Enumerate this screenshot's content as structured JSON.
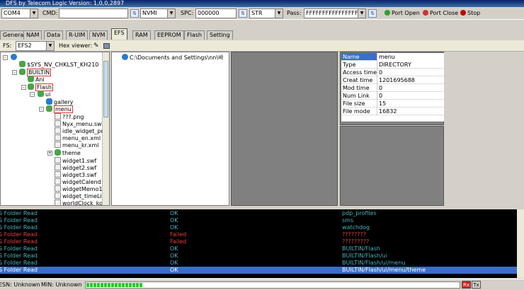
{
  "window": {
    "title": "DFS by Telecom Logic  Version: 1,0,0,2897"
  },
  "toolbar": {
    "port": "COM4",
    "cmd_label": "CMD:",
    "cmd_value": "",
    "nv_mode": "NVMI",
    "spc_label": "SPC:",
    "spc_value": "000000",
    "str_mode": "STR",
    "pass_label": "Pass:",
    "pass_value": "FFFFFFFFFFFFFFFF",
    "port_open": "Port Open",
    "port_close": "Port Close",
    "stop": "Stop"
  },
  "tabs": [
    "General",
    "NAM",
    "Data",
    "R-UIM",
    "NVM",
    "EFS",
    "RAM",
    "EEPROM",
    "Flash",
    "Setting"
  ],
  "active_tab": "EFS",
  "fsbar": {
    "fs_label": "FS:",
    "fs_value": "EFS2",
    "hex_label": "Hex viewer:"
  },
  "tree": {
    "root": "$SYS_NV_CHKLST_KH210",
    "builtin": "BUILTIN",
    "ani": "Ani",
    "flash": "Flash",
    "ui": "ui",
    "gallery": "gallery",
    "menu": "menu",
    "files": [
      "???.png",
      "Nyx_menu.sw",
      "idle_widget_pr",
      "menu_en.xml",
      "menu_kr.xml"
    ],
    "theme": "theme",
    "files2": [
      "widget1.swf",
      "widget2.swf",
      "widget3.swf",
      "widgetCalend",
      "widgetMemo1.",
      "widget_timeLis",
      "worldClock_ko"
    ]
  },
  "path": "C:\\Documents and Settings\\nn\\바",
  "info": [
    {
      "k": "Name",
      "v": "menu"
    },
    {
      "k": "Type",
      "v": "DIRECTORY"
    },
    {
      "k": "Access time",
      "v": "0"
    },
    {
      "k": "Creat time",
      "v": "1201695688"
    },
    {
      "k": "Mod time",
      "v": "0"
    },
    {
      "k": "Num Link",
      "v": "0"
    },
    {
      "k": "File size",
      "v": "15"
    },
    {
      "k": "File mode",
      "v": "16832"
    }
  ],
  "log": [
    {
      "a": "S Folder Read",
      "b": "OK",
      "c": "pdp_profiles",
      "s": "ok"
    },
    {
      "a": "S Folder Read",
      "b": "OK",
      "c": "sms",
      "s": "ok"
    },
    {
      "a": "S Folder Read",
      "b": "OK",
      "c": "watchdog",
      "s": "ok"
    },
    {
      "a": "S Folder Read",
      "b": "Failed",
      "c": "????????",
      "s": "fail"
    },
    {
      "a": "S Folder Read",
      "b": "Failed",
      "c": "?????????",
      "s": "fail"
    },
    {
      "a": "S Folder Read",
      "b": "OK",
      "c": "BUILTIN/Flash",
      "s": "ok"
    },
    {
      "a": "S Folder Read",
      "b": "OK",
      "c": "BUILTIN/Flash/ui",
      "s": "ok"
    },
    {
      "a": "S Folder Read",
      "b": "OK",
      "c": "BUILTIN/Flash/ui/menu",
      "s": "ok"
    },
    {
      "a": "S Folder Read",
      "b": "OK",
      "c": "BUILTIN/Flash/ui/menu/theme",
      "s": "sel"
    }
  ],
  "status": {
    "esn": "ESN: Unknown",
    "min": "MIN: Unknown",
    "progress": 0.15,
    "rx": "Rx",
    "tx": "Tx"
  },
  "colors": {
    "accent": "#3a6ec8",
    "ok": "#4fb0b8",
    "fail": "#e04040",
    "progress": "#2ec82e"
  }
}
